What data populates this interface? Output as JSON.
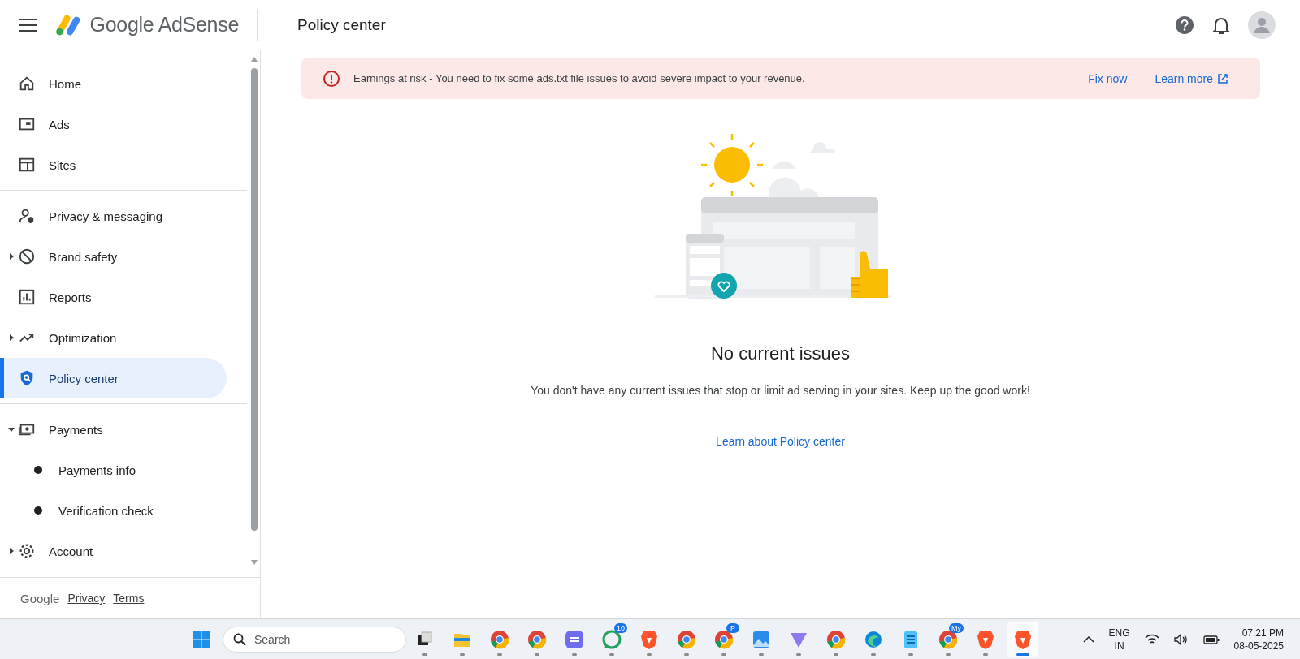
{
  "header": {
    "logo_text": "Google AdSense",
    "page_title": "Policy center"
  },
  "sidebar": {
    "sections": [
      {
        "items": [
          {
            "label": "Home",
            "selected": false
          },
          {
            "label": "Ads",
            "selected": false
          },
          {
            "label": "Sites",
            "selected": false
          }
        ]
      },
      {
        "items": [
          {
            "label": "Privacy & messaging",
            "selected": false
          },
          {
            "label": "Brand safety",
            "expanded": false,
            "selected": false
          },
          {
            "label": "Reports",
            "selected": false
          },
          {
            "label": "Optimization",
            "expanded": false,
            "selected": false
          },
          {
            "label": "Policy center",
            "selected": true
          }
        ]
      },
      {
        "items": [
          {
            "label": "Payments",
            "expanded": true,
            "selected": false,
            "children": [
              {
                "label": "Payments info",
                "selected": false
              },
              {
                "label": "Verification check",
                "selected": false
              }
            ]
          },
          {
            "label": "Account",
            "expanded": false,
            "selected": false
          }
        ]
      }
    ],
    "footer": {
      "brand": "Google",
      "links": [
        "Privacy",
        "Terms"
      ]
    }
  },
  "banner": {
    "message": "Earnings at risk - You need to fix some ads.txt file issues to avoid severe impact to your revenue.",
    "actions": [
      {
        "label": "Fix now",
        "external": false
      },
      {
        "label": "Learn more",
        "external": true
      }
    ]
  },
  "empty_state": {
    "title": "No current issues",
    "message": "You don't have any current issues that stop or limit ad serving in your sites. Keep up the good work!",
    "link": "Learn about Policy center"
  },
  "taskbar": {
    "search_placeholder": "Search",
    "apps": [
      {
        "kind": "taskview",
        "selected": false
      },
      {
        "kind": "folder",
        "selected": false
      },
      {
        "kind": "chrome",
        "selected": false
      },
      {
        "kind": "chrome",
        "selected": false
      },
      {
        "kind": "purple",
        "selected": false
      },
      {
        "kind": "whatsapp",
        "badge": "10",
        "selected": false
      },
      {
        "kind": "brave",
        "selected": false
      },
      {
        "kind": "chrome",
        "selected": false
      },
      {
        "kind": "chrome",
        "badge": "P",
        "selected": false
      },
      {
        "kind": "photos",
        "selected": false
      },
      {
        "kind": "vpn",
        "selected": false
      },
      {
        "kind": "chrome",
        "selected": false
      },
      {
        "kind": "edge",
        "selected": false
      },
      {
        "kind": "notepad",
        "selected": false
      },
      {
        "kind": "chrome",
        "badge": "My",
        "selected": false
      },
      {
        "kind": "brave",
        "selected": false
      },
      {
        "kind": "brave",
        "selected": true
      }
    ],
    "language": [
      "ENG",
      "IN"
    ],
    "time": "07:21 PM",
    "date": "08-05-2025"
  }
}
